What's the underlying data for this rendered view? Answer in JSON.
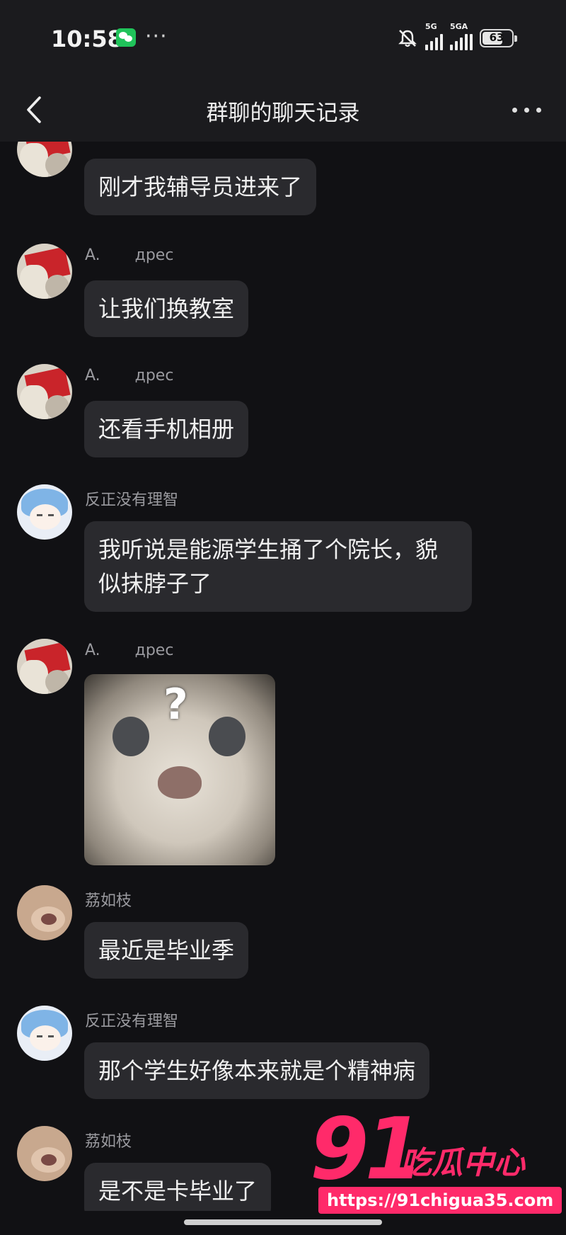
{
  "status": {
    "time": "10:58",
    "net1": "5G",
    "net2": "5GA",
    "battery": "63"
  },
  "nav": {
    "title": "群聊的聊天记录"
  },
  "messages": [
    {
      "sender": "",
      "text": "刚才我辅导员进来了"
    },
    {
      "sender": "A.       дрес",
      "text": "让我们换教室"
    },
    {
      "sender": "A.       дрес",
      "text": "还看手机相册"
    },
    {
      "sender": "反正没有理智",
      "text": "我听说是能源学生捅了个院长，貌似抹脖子了"
    },
    {
      "sender": "A.       дрес",
      "text": "",
      "sticker": "cat-question-sticker"
    },
    {
      "sender": "荔如枝",
      "text": "最近是毕业季"
    },
    {
      "sender": "反正没有理智",
      "text": "那个学生好像本来就是个精神病"
    },
    {
      "sender": "荔如枝",
      "text": "是不是卡毕业了"
    }
  ],
  "sticker": {
    "mark": "?"
  },
  "watermark": {
    "number": "91",
    "brand": "吃瓜中心",
    "url": "https://91chigua35.com"
  },
  "colors": {
    "background": "#111114",
    "bubble": "#2a2a2e",
    "watermark": "#ff2a6a",
    "wechat": "#20c35a"
  }
}
